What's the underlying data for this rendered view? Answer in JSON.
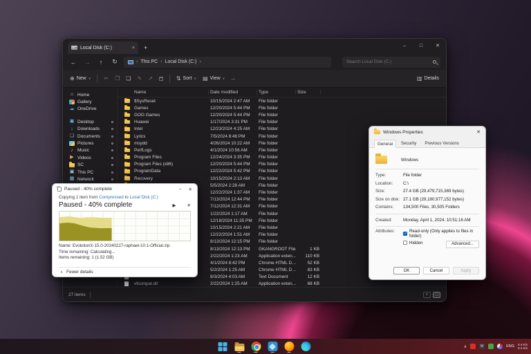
{
  "explorer": {
    "tab": {
      "title": "Local Disk (C:)"
    },
    "breadcrumb": {
      "items": [
        "This PC",
        "Local Disk (C:)"
      ]
    },
    "search": {
      "placeholder": "Search Local Disk (C:)"
    },
    "toolbar": {
      "new_label": "New",
      "sort_label": "Sort",
      "view_label": "View",
      "more_label": "...",
      "details_label": "Details"
    },
    "sidebar": {
      "items": [
        {
          "label": "Home",
          "icon": "home",
          "glyph": "⌂",
          "pinned": false
        },
        {
          "label": "Gallery",
          "icon": "gallery",
          "glyph": "",
          "pinned": false
        },
        {
          "label": "OneDrive",
          "icon": "onedrive",
          "glyph": "☁",
          "pinned": false
        },
        {
          "label": "Desktop",
          "icon": "desktop",
          "glyph": "▣",
          "pinned": true
        },
        {
          "label": "Downloads",
          "icon": "downloads",
          "glyph": "↓",
          "pinned": true
        },
        {
          "label": "Documents",
          "icon": "documents",
          "glyph": "❏",
          "pinned": true
        },
        {
          "label": "Pictures",
          "icon": "pictures",
          "glyph": "",
          "pinned": true
        },
        {
          "label": "Music",
          "icon": "music",
          "glyph": "♪",
          "pinned": true
        },
        {
          "label": "Videos",
          "icon": "videos",
          "glyph": "▶",
          "pinned": true
        },
        {
          "label": "SC",
          "icon": "folder",
          "glyph": "",
          "pinned": true
        },
        {
          "label": "This PC",
          "icon": "thispc",
          "glyph": "▣",
          "pinned": true
        },
        {
          "label": "Network",
          "icon": "network",
          "glyph": "▦",
          "pinned": true
        }
      ]
    },
    "list": {
      "columns": [
        "Name",
        "Date modified",
        "Type",
        "Size"
      ],
      "rows": [
        {
          "icon": "folder",
          "name": "$SysReset",
          "date": "10/15/2024 2:47 AM",
          "type": "File folder",
          "size": ""
        },
        {
          "icon": "folder",
          "name": "Games",
          "date": "12/20/2024 5:44 PM",
          "type": "File folder",
          "size": ""
        },
        {
          "icon": "folder",
          "name": "GOG Games",
          "date": "12/20/2024 5:44 PM",
          "type": "File folder",
          "size": ""
        },
        {
          "icon": "folder",
          "name": "Huawei",
          "date": "1/17/2024 3:31 PM",
          "type": "File folder",
          "size": ""
        },
        {
          "icon": "folder",
          "name": "Intel",
          "date": "12/23/2024 4:25 AM",
          "type": "File folder",
          "size": ""
        },
        {
          "icon": "folder",
          "name": "Lyrics",
          "date": "7/5/2024 8:48 PM",
          "type": "File folder",
          "size": ""
        },
        {
          "icon": "folder",
          "name": "msydd",
          "date": "4/26/2024 10:22 AM",
          "type": "File folder",
          "size": ""
        },
        {
          "icon": "folder",
          "name": "PerfLogs",
          "date": "4/1/2024 10:56 AM",
          "type": "File folder",
          "size": ""
        },
        {
          "icon": "folder",
          "name": "Program Files",
          "date": "12/24/2024 3:35 PM",
          "type": "File folder",
          "size": ""
        },
        {
          "icon": "folder",
          "name": "Program Files (x86)",
          "date": "12/20/2024 5:44 PM",
          "type": "File folder",
          "size": ""
        },
        {
          "icon": "folder",
          "name": "ProgramData",
          "date": "12/22/2024 5:42 PM",
          "type": "File folder",
          "size": ""
        },
        {
          "icon": "folder",
          "name": "Recovery",
          "date": "10/15/2024 2:13 AM",
          "type": "File folder",
          "size": ""
        },
        {
          "icon": "folder",
          "name": "",
          "date": "5/5/2024 2:28 AM",
          "type": "File folder",
          "size": ""
        },
        {
          "icon": "folder",
          "name": "",
          "date": "12/22/2024 1:37 AM",
          "type": "File folder",
          "size": ""
        },
        {
          "icon": "folder",
          "name": "",
          "date": "7/13/2024 12:44 PM",
          "type": "File folder",
          "size": ""
        },
        {
          "icon": "folder",
          "name": "",
          "date": "7/12/2024 12:31 AM",
          "type": "File folder",
          "size": ""
        },
        {
          "icon": "folder",
          "name": "",
          "date": "1/22/2024 1:17 AM",
          "type": "File folder",
          "size": ""
        },
        {
          "icon": "folder",
          "name": "",
          "date": "12/18/2024 11:35 PM",
          "type": "File folder",
          "size": ""
        },
        {
          "icon": "folder",
          "name": "",
          "date": "10/15/2024 2:21 AM",
          "type": "File folder",
          "size": ""
        },
        {
          "icon": "folder",
          "name": "",
          "date": "12/22/2024 1:51 AM",
          "type": "File folder",
          "size": ""
        },
        {
          "icon": "folder",
          "name": "",
          "date": "8/13/2024 12:15 PM",
          "type": "File folder",
          "size": ""
        },
        {
          "icon": "file",
          "name": "",
          "date": "8/13/2024 12:13 PM",
          "type": "GKANGROOT File",
          "size": "1 KB"
        },
        {
          "icon": "file",
          "name": "",
          "date": "2/22/2024 1:23 AM",
          "type": "Application exten...",
          "size": "110 KB"
        },
        {
          "icon": "file",
          "name": "",
          "date": "4/1/2024 8:42 PM",
          "type": "Chrome HTML Do...",
          "size": "52 KB"
        },
        {
          "icon": "file",
          "name": "",
          "date": "5/2/2024 1:25 AM",
          "type": "Chrome HTML Do...",
          "size": "83 KB"
        },
        {
          "icon": "file",
          "name": "",
          "date": "8/3/2024 4:03 AM",
          "type": "Text Document",
          "size": "12 KB"
        },
        {
          "icon": "file",
          "name": "vfcompat.dll",
          "date": "2/22/2024 1:25 AM",
          "type": "Application exten...",
          "size": "68 KB"
        }
      ]
    },
    "status_bar": {
      "items_count": "27 items"
    }
  },
  "copy_dialog": {
    "title": "Paused - 40% complete",
    "copy_line": {
      "prefix": "Copying 1 item from ",
      "source": "Compressed",
      "middle": " to ",
      "destination": "Local Disk (C:)"
    },
    "status_heading": "Paused - 40% complete",
    "resume_glyph": "▶",
    "cancel_glyph": "✕",
    "details": [
      {
        "label": "Name:",
        "value": "EvolutionX-15.0-20240227-raphael-10.1-Official.zip"
      },
      {
        "label": "Time remaining:",
        "value": "Calculating..."
      },
      {
        "label": "Items remaining:",
        "value": "1 (1.52 GB)"
      }
    ],
    "fewer_details_label": "Fewer details",
    "graph": {
      "fill_percent": 40,
      "colors": {
        "light": "#e4dc88",
        "dark": "#9a9223",
        "grid": "#e0e3d2"
      }
    }
  },
  "properties_dialog": {
    "title": "Windows Properties",
    "tabs": [
      "General",
      "Security",
      "Previous Versions"
    ],
    "active_tab": "General",
    "folder_name": "Windows",
    "fields": [
      {
        "label": "Type:",
        "value": "File folder"
      },
      {
        "label": "Location:",
        "value": "C:\\"
      },
      {
        "label": "Size:",
        "value": "27.4 GB (29,479,715,369 bytes)"
      },
      {
        "label": "Size on disk:",
        "value": "27.1 GB (29,180,977,152 bytes)"
      },
      {
        "label": "Contains:",
        "value": "134,500 Files, 30,505 Folders"
      },
      {
        "label": "Created:",
        "value": "Monday, April 1, 2024, 10:51:16 AM"
      }
    ],
    "attributes": {
      "label": "Attributes:",
      "read_only": {
        "label": "Read-only (Only applies to files in folder)",
        "checked": true
      },
      "hidden": {
        "label": "Hidden",
        "checked": false
      },
      "advanced_label": "Advanced..."
    },
    "buttons": {
      "ok": "OK",
      "cancel": "Cancel",
      "apply": "Apply"
    }
  },
  "taskbar": {
    "apps": [
      {
        "name": "start",
        "running": false
      },
      {
        "name": "file-explorer",
        "running": true
      },
      {
        "name": "chrome",
        "running": true
      },
      {
        "name": "photos",
        "running": true
      },
      {
        "name": "firefox",
        "running": true
      },
      {
        "name": "edge",
        "running": false
      }
    ],
    "tray": {
      "language": "ENG",
      "net_speed_up": "0.4 K/s",
      "net_speed_down": "0.4 K/s"
    }
  },
  "colors": {
    "accent_blue": "#0067c0",
    "link_blue": "#2f6fbe",
    "folder_yellow": "#ffd565",
    "glow_pink": "#fa4896"
  }
}
